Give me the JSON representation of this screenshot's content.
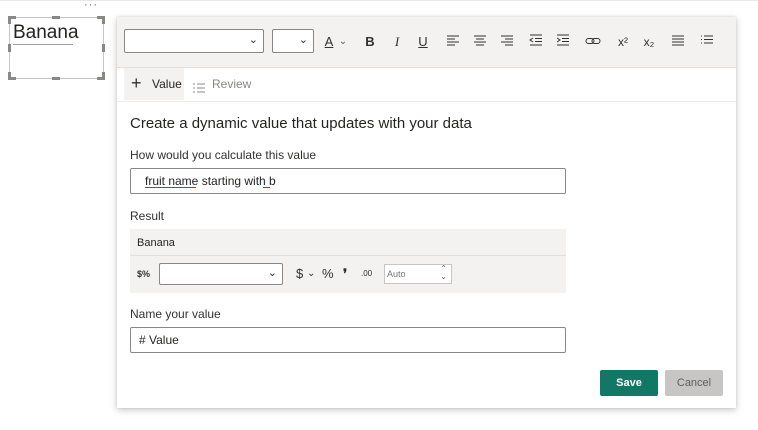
{
  "textbox": {
    "text": "Banana",
    "more_glyph": "···"
  },
  "toolbar": {
    "font_family_value": "",
    "font_size_value": "",
    "font_color_glyph": "A",
    "bold_glyph": "B",
    "italic_glyph": "I",
    "underline_glyph": "U",
    "superscript_glyph": "x²",
    "subscript_glyph": "x₂"
  },
  "tabs": [
    {
      "label": "Value",
      "icon": "plus-icon",
      "active": true
    },
    {
      "label": "Review",
      "icon": "list-review-icon",
      "active": false
    }
  ],
  "heading": "Create a dynamic value that updates with your data",
  "calc": {
    "label": "How would you calculate this value",
    "value": "fruit name starting with b",
    "underlined_terms": [
      "fruit name",
      "b"
    ]
  },
  "result": {
    "label": "Result",
    "value": "Banana",
    "format_select_value": "",
    "currency_glyph": "$",
    "percent_glyph": "%",
    "comma_glyph": "❜",
    "decimal_glyph": ".00",
    "decimal_placeholder": "Auto"
  },
  "name": {
    "label": "Name your value",
    "value": "# Value"
  },
  "buttons": {
    "save": "Save",
    "cancel": "Cancel"
  },
  "colors": {
    "save_bg": "#117865",
    "cancel_bg": "#c8c6c4",
    "underline_blue": "#0f6cbd"
  }
}
